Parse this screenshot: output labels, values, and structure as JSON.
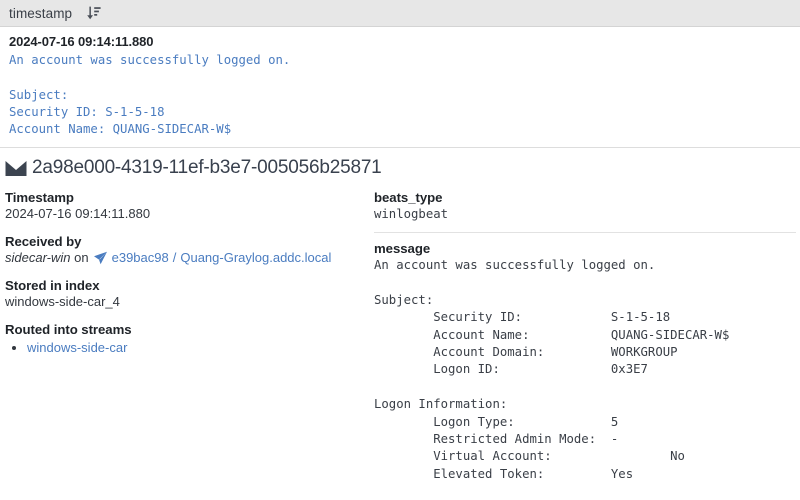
{
  "column_header": {
    "label": "timestamp",
    "sort_icon": "sort-descending-icon"
  },
  "preview": {
    "timestamp": "2024-07-16 09:14:11.880",
    "message": "An account was successfully logged on.\n\nSubject:\nSecurity ID: S-1-5-18\nAccount Name: QUANG-SIDECAR-W$"
  },
  "message_header": {
    "icon": "envelope-icon",
    "id": "2a98e000-4319-11ef-b3e7-005056b25871"
  },
  "left_panel": {
    "timestamp_label": "Timestamp",
    "timestamp_value": "2024-07-16 09:14:11.880",
    "received_by_label": "Received by",
    "received_input": "sidecar-win",
    "received_on_word": "on",
    "received_node_icon": "sidecar-node-icon",
    "received_node_id": "e39bac98",
    "received_separator": "/",
    "received_node_name": "Quang-Graylog.addc.local",
    "stored_in_index_label": "Stored in index",
    "stored_in_index_value": "windows-side-car_4",
    "routed_into_streams_label": "Routed into streams",
    "streams": [
      "windows-side-car"
    ]
  },
  "right_panel": {
    "fields": [
      {
        "name": "beats_type",
        "value": "winlogbeat"
      },
      {
        "name": "message",
        "value": "An account was successfully logged on.\n\nSubject:\n        Security ID:            S-1-5-18\n        Account Name:           QUANG-SIDECAR-W$\n        Account Domain:         WORKGROUP\n        Logon ID:               0x3E7\n\nLogon Information:\n        Logon Type:             5\n        Restricted Admin Mode:  -\n        Virtual Account:                No\n        Elevated Token:         Yes"
      }
    ]
  },
  "colors": {
    "header_bg": "#e7e7e7",
    "link_blue": "#4a7cc0",
    "text_dark": "#2b2f36",
    "envelope_dark": "#3c4450",
    "divider": "#dddddd"
  }
}
